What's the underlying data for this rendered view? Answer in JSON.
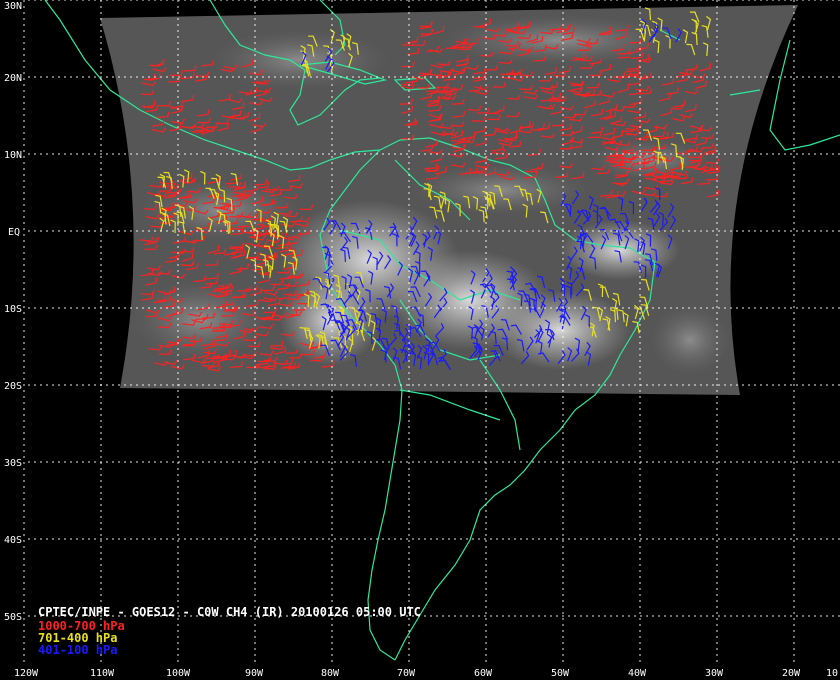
{
  "map": {
    "lat_labels": [
      "30N",
      "20N",
      "10N",
      "EQ",
      "10S",
      "20S",
      "30S",
      "40S",
      "50S"
    ],
    "lon_labels": [
      "120W",
      "110W",
      "100W",
      "90W",
      "80W",
      "70W",
      "60W",
      "50W",
      "40W",
      "30W",
      "20W",
      "10"
    ],
    "colors": {
      "background": "#000000",
      "grid": "#ffffff",
      "coast": "#2ee89a",
      "low": "#ff2020",
      "mid": "#e8e020",
      "high": "#1a1aff",
      "caption": "#ffffff"
    }
  },
  "caption": {
    "title": "CPTEC/INPE - GOES12 - C0W CH4 (IR) 20100126 05:00 UTC",
    "legend": [
      {
        "label": "1000-700 hPa",
        "color": "#ff2020"
      },
      {
        "label": "701-400 hPa",
        "color": "#e8e020"
      },
      {
        "label": "401-100 hPa",
        "color": "#1a1aff"
      }
    ]
  }
}
